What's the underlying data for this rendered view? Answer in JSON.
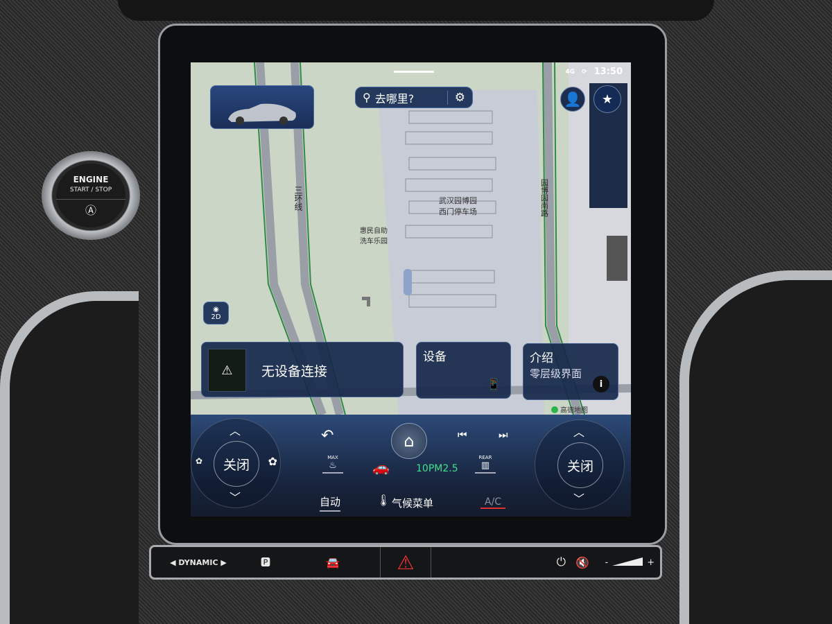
{
  "console": {
    "engine_button": {
      "line1": "ENGINE",
      "line2": "START / STOP",
      "icon": "auto-start-stop-icon"
    }
  },
  "status": {
    "network": "4G",
    "time": "13:50"
  },
  "map": {
    "search_placeholder": "去哪里?",
    "labels": {
      "ring_road": "三环线",
      "parking": [
        "武汉园博园",
        "西门停车场"
      ],
      "carwash": [
        "惠民自助",
        "洗车乐园"
      ],
      "road_right": "园博园南路"
    },
    "view_mode": "2D",
    "provider": "高德地图"
  },
  "cards": {
    "warning": {
      "text": "无设备连接",
      "icon": "warning-icon"
    },
    "device": {
      "title": "设备",
      "icon": "phone-connect-icon"
    },
    "intro": {
      "title": "介绍",
      "subtitle": "零层级界面",
      "icon": "info-icon"
    }
  },
  "climate": {
    "left_temp": "关闭",
    "right_temp": "关闭",
    "max_label": "MAX",
    "rear_label": "REAR",
    "air_quality": "10PM2.5",
    "auto": "自动",
    "menu": "气候菜单",
    "ac": "A/C"
  },
  "hardware_bar": {
    "drive_mode": "DYNAMIC"
  },
  "colors": {
    "card_bg": "#16284b",
    "pm_green": "#3fe08a",
    "ac_off_red": "#e03030",
    "hazard_red": "#e33333"
  }
}
